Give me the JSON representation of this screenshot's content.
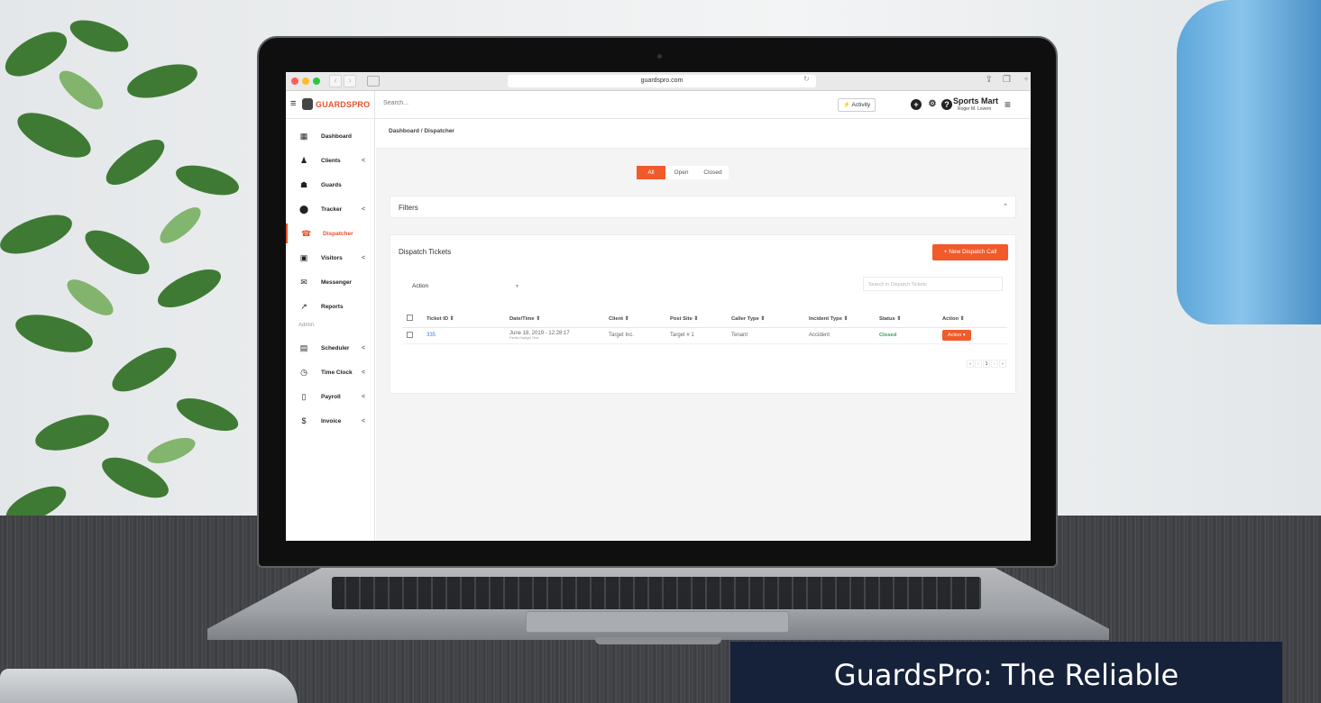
{
  "browser": {
    "url": "guardspro.com"
  },
  "app": {
    "brand": "GUARDSPRO",
    "search_placeholder": "Search...",
    "activity_label": "Activity",
    "company": "Sports Mart",
    "user": "Roger M. Lovern"
  },
  "sidebar": {
    "items": [
      {
        "label": "Dashboard",
        "icon": "grid-icon"
      },
      {
        "label": "Clients",
        "icon": "clients-icon",
        "chevron": "<"
      },
      {
        "label": "Guards",
        "icon": "guard-icon"
      },
      {
        "label": "Tracker",
        "icon": "map-pin-icon",
        "chevron": "<"
      },
      {
        "label": "Dispatcher",
        "icon": "dispatcher-icon",
        "active": true
      },
      {
        "label": "Visitors",
        "icon": "visitor-card-icon",
        "chevron": "<"
      },
      {
        "label": "Messenger",
        "icon": "envelope-icon"
      },
      {
        "label": "Reports",
        "icon": "chart-icon"
      }
    ],
    "admin_label": "Admin",
    "admin_items": [
      {
        "label": "Scheduler",
        "icon": "calendar-icon",
        "chevron": "<"
      },
      {
        "label": "Time Clock",
        "icon": "clock-icon",
        "chevron": "<"
      },
      {
        "label": "Payroll",
        "icon": "document-icon",
        "chevron": "<"
      },
      {
        "label": "Invoice",
        "icon": "invoice-icon",
        "chevron": "<"
      }
    ]
  },
  "breadcrumb": "Dashboard / Dispatcher",
  "filter_tabs": {
    "all": "All",
    "open": "Open",
    "closed": "Closed"
  },
  "filters_title": "Filters",
  "tickets": {
    "title": "Dispatch Tickets",
    "new_button": "+ New Dispatch Call",
    "action_select": "Action",
    "search_placeholder": "Search in Dispatch Tickets",
    "columns": [
      "Ticket ID ⇕",
      "Date/Time ⇕",
      "Client ⇕",
      "Post Site ⇕",
      "Caller Type ⇕",
      "Incident Type ⇕",
      "Status ⇕",
      "Action ⇕"
    ],
    "rows": [
      {
        "id": "335",
        "datetime": "June 18, 2019 - 12:28:17",
        "timezone": "Pacific Daylight Time",
        "client": "Target Inc.",
        "post_site": "Target # 1",
        "caller_type": "Tenant",
        "incident_type": "Accident",
        "status": "Closed",
        "action": "Action ▾"
      }
    ],
    "pager": [
      "«",
      "‹",
      "1",
      "›",
      "»"
    ]
  },
  "caption": "GuardsPro: The Reliable",
  "colors": {
    "accent": "#f15a2b",
    "navy": "#16213a",
    "status_closed": "#2ea44f"
  }
}
